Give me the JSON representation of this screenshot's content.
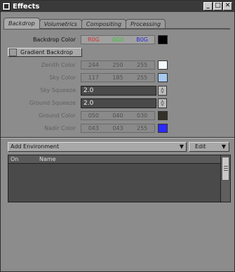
{
  "window": {
    "title": "Effects"
  },
  "titlebar_buttons": [
    "_",
    "□",
    "✕"
  ],
  "tabs": [
    {
      "label": "Backdrop",
      "active": true
    },
    {
      "label": "Volumetrics",
      "active": false
    },
    {
      "label": "Compositing",
      "active": false
    },
    {
      "label": "Processing",
      "active": false
    }
  ],
  "backdrop": {
    "backdrop_color": {
      "label": "Backdrop Color",
      "r": "R0G",
      "g": "0G0",
      "b": "B0G"
    },
    "gradient_button": {
      "label": "Gradient Backdrop",
      "checked": false
    },
    "zenith_color": {
      "label": "Zenith Color",
      "r": "244",
      "g": "250",
      "b": "255",
      "swatch": "#f4faff"
    },
    "sky_color": {
      "label": "Sky Color",
      "r": "117",
      "g": "185",
      "b": "255",
      "swatch": "#a8c8f0"
    },
    "sky_squeeze": {
      "label": "Sky Squeeze",
      "value": "2.0"
    },
    "ground_squeeze": {
      "label": "Ground Squeeze",
      "value": "2.0"
    },
    "ground_color": {
      "label": "Ground Color",
      "r": "050",
      "g": "040",
      "b": "030",
      "swatch": "#323228"
    },
    "nadir_color": {
      "label": "Nadir Color",
      "r": "043",
      "g": "043",
      "b": "255",
      "swatch": "#2b2bff"
    }
  },
  "environment": {
    "dropdown": {
      "value": "Add Environment"
    },
    "edit_button": {
      "label": "Edit"
    },
    "list_headers": {
      "on": "On",
      "name": "Name"
    }
  }
}
